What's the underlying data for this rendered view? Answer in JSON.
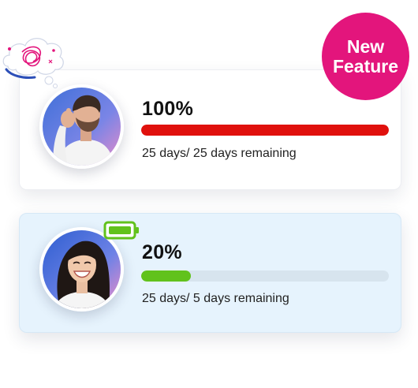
{
  "badge": {
    "line1": "New",
    "line2": "Feature",
    "color": "#e3157c"
  },
  "cards": [
    {
      "percent_label": "100%",
      "progress": 1.0,
      "days_text": "25 days/ 25 days remaining",
      "bar_color": "#e0110d",
      "background": "#ffffff",
      "status_icon": "tangled-thought-cloud-icon",
      "avatar": "stressed-man-avatar"
    },
    {
      "percent_label": "20%",
      "progress": 0.2,
      "days_text": "25 days/ 5 days remaining",
      "bar_color": "#61c21c",
      "background": "#e6f3fd",
      "status_icon": "battery-icon",
      "avatar": "smiling-woman-avatar"
    }
  ]
}
